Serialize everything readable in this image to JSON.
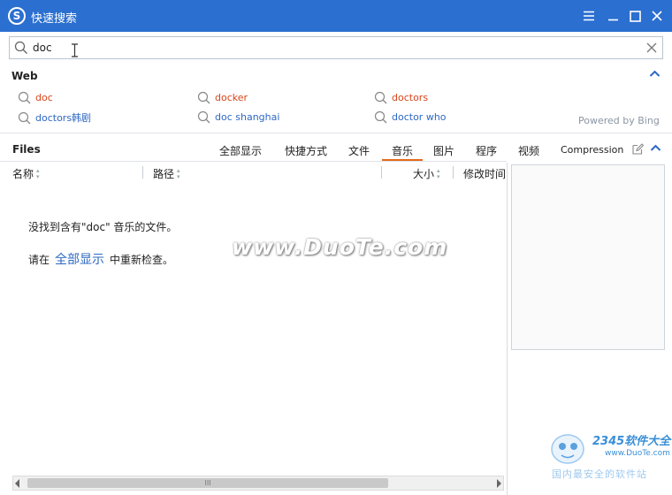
{
  "window": {
    "title": "快速搜索",
    "logo_glyph": "S"
  },
  "search": {
    "value": "doc"
  },
  "web": {
    "section_title": "Web",
    "suggestions": [
      {
        "text": "doc",
        "color": "#d8441a"
      },
      {
        "text": "docker",
        "color": "#d8441a"
      },
      {
        "text": "doctors",
        "color": "#d8441a"
      },
      {
        "text": "doctors韩剧",
        "color": "#2d68c4"
      },
      {
        "text": "doc shanghai",
        "color": "#2d68c4"
      },
      {
        "text": "doctor who",
        "color": "#2d68c4"
      }
    ],
    "powered_by": "Powered by Bing"
  },
  "files": {
    "section_title": "Files",
    "tabs": [
      {
        "label": "全部显示"
      },
      {
        "label": "快捷方式"
      },
      {
        "label": "文件"
      },
      {
        "label": "音乐",
        "active": true
      },
      {
        "label": "图片"
      },
      {
        "label": "程序"
      },
      {
        "label": "视频"
      },
      {
        "label": "Compression"
      }
    ],
    "columns": [
      {
        "label": "名称"
      },
      {
        "label": "路径"
      },
      {
        "label": "大小"
      },
      {
        "label": "修改时间"
      }
    ],
    "empty_message": "没找到含有\"doc\" 音乐的文件。",
    "retry_prefix": "请在",
    "retry_link": "全部显示",
    "retry_suffix": "中重新检查。"
  },
  "scrollbar": {
    "thumb_grip": "III"
  },
  "watermark": {
    "text": "www.DuoTe.com"
  },
  "corner_logo": {
    "brand": "2345软件大全",
    "url": "www.DuoTe.com",
    "slogan": "国内最安全的软件站"
  },
  "colors": {
    "titlebar": "#2b6fd0",
    "active_tab_underline": "#e46a1a",
    "link_blue": "#2d68c4",
    "suggest_red": "#d8441a"
  }
}
